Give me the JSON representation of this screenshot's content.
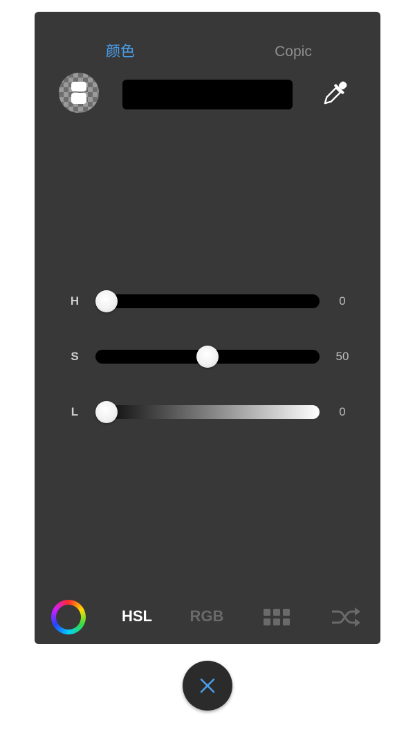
{
  "tabs": {
    "color_label": "颜色",
    "copic_label": "Copic"
  },
  "colors": {
    "accent": "#4a9eea",
    "panel_background": "#383838",
    "current_color": "#000000"
  },
  "sliders": [
    {
      "label": "H",
      "value": "0",
      "fraction": 0.0
    },
    {
      "label": "S",
      "value": "50",
      "fraction": 0.5
    },
    {
      "label": "L",
      "value": "0",
      "fraction": 0.0
    }
  ],
  "bottom_bar": {
    "wheel_icon": "color-wheel-icon",
    "hsl_label": "HSL",
    "rgb_label": "RGB",
    "palette_icon": "grid-icon",
    "random_icon": "shuffle-icon",
    "active_mode": "HSL"
  },
  "icons": {
    "eraser": "eraser-icon",
    "eyedropper": "eyedropper-icon",
    "close": "close-icon"
  }
}
